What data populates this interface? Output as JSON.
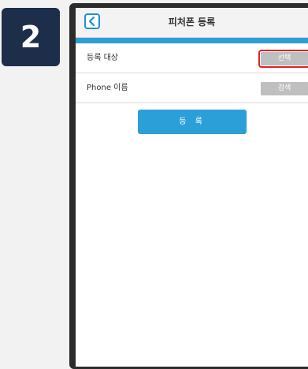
{
  "step": {
    "number": "2"
  },
  "header": {
    "title": "피처폰 등록",
    "back_icon": "chevron-left-icon"
  },
  "form": {
    "rows": [
      {
        "label": "등록 대상",
        "button_label": "선택",
        "highlighted": true
      },
      {
        "label": "Phone 이름",
        "button_label": "검색",
        "highlighted": false
      }
    ],
    "register_label": "등 록"
  },
  "colors": {
    "accent": "#2a9fd8",
    "highlight": "#e21f1f",
    "badge": "#1c2e4a"
  }
}
